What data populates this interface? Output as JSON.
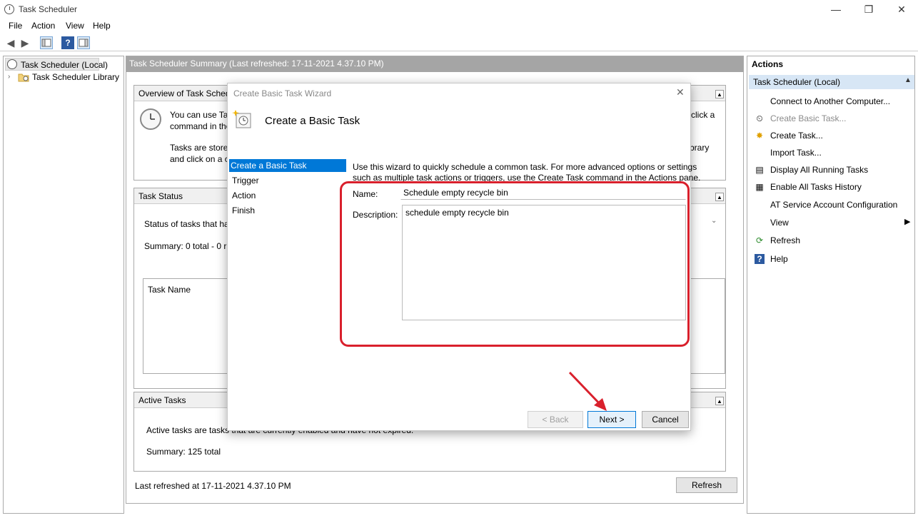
{
  "window": {
    "title": "Task Scheduler",
    "controls": {
      "minimize": "—",
      "maximize": "❐",
      "close": "✕"
    }
  },
  "menu": [
    "File",
    "Action",
    "View",
    "Help"
  ],
  "tree": {
    "root": "Task Scheduler (Local)",
    "child": "Task Scheduler Library"
  },
  "center": {
    "header": "Task Scheduler Summary (Last refreshed: 17-11-2021 4.37.10 PM)",
    "overview": {
      "title": "Overview of Task Schedul",
      "line1a": "You can use Task",
      "line1b": "command in the",
      "line1c": "click a",
      "line2a": "Tasks are stored i",
      "line2b": "and click on a co",
      "line2c": "brary"
    },
    "status": {
      "title": "Task Status",
      "status_label": "Status of tasks that have",
      "summary": "Summary: 0 total - 0 run",
      "column": "Task Name"
    },
    "active": {
      "title": "Active Tasks",
      "desc": "Active tasks are tasks that are currently enabled and have not expired.",
      "summary": "Summary: 125 total"
    },
    "last_refreshed": "Last refreshed at 17-11-2021 4.37.10 PM",
    "refresh_button": "Refresh"
  },
  "actions": {
    "heading": "Actions",
    "group": "Task Scheduler (Local)",
    "items": [
      {
        "label": "Connect to Another Computer...",
        "icon": "none",
        "disabled": false
      },
      {
        "label": "Create Basic Task...",
        "icon": "create-basic-task-icon",
        "disabled": true
      },
      {
        "label": "Create Task...",
        "icon": "create-task-icon",
        "disabled": false
      },
      {
        "label": "Import Task...",
        "icon": "none",
        "disabled": false
      },
      {
        "label": "Display All Running Tasks",
        "icon": "running-tasks-icon",
        "disabled": false
      },
      {
        "label": "Enable All Tasks History",
        "icon": "history-icon",
        "disabled": false
      },
      {
        "label": "AT Service Account Configuration",
        "icon": "none",
        "disabled": false
      },
      {
        "label": "View",
        "icon": "none",
        "disabled": false
      },
      {
        "label": "Refresh",
        "icon": "refresh-icon",
        "disabled": false
      },
      {
        "label": "Help",
        "icon": "help-icon",
        "disabled": false
      }
    ]
  },
  "wizard": {
    "window_title": "Create Basic Task Wizard",
    "heading": "Create a Basic Task",
    "steps": [
      "Create a Basic Task",
      "Trigger",
      "Action",
      "Finish"
    ],
    "active_step": 0,
    "intro1": "Use this wizard to quickly schedule a common task.  For more advanced options or settings",
    "intro2": "such as multiple task actions or triggers, use the Create Task command in the Actions pane.",
    "name_label": "Name:",
    "name_value": "Schedule empty recycle bin",
    "description_label": "Description:",
    "description_value": "schedule empty recycle bin",
    "back_button": "< Back",
    "next_button": "Next >",
    "cancel_button": "Cancel"
  },
  "colors": {
    "selection": "#0078d7",
    "highlight": "#d9202c",
    "header_gray": "#a5a5a5"
  }
}
